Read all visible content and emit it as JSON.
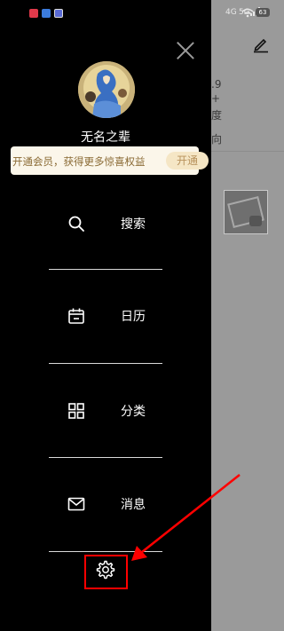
{
  "background": {
    "status_net": "4G",
    "status_5g": "5G",
    "battery": "63",
    "text_fragments": [
      ".9",
      "+",
      "度",
      "向"
    ]
  },
  "drawer": {
    "username": "无名之辈",
    "vip_banner": {
      "text": "开通会员，获得更多惊喜权益",
      "button": "开通"
    },
    "menu": [
      {
        "label": "搜索",
        "icon": "search-icon"
      },
      {
        "label": "日历",
        "icon": "calendar-icon"
      },
      {
        "label": "分类",
        "icon": "grid-icon"
      },
      {
        "label": "消息",
        "icon": "mail-icon"
      }
    ],
    "settings_icon": "gear-icon"
  },
  "colors": {
    "drawer_bg": "#000000",
    "overlay_bg": "#9a9a9a",
    "vip_text": "#8a6a34",
    "vip_button_bg": "#f5e6c5",
    "annotation": "#ff0000"
  }
}
